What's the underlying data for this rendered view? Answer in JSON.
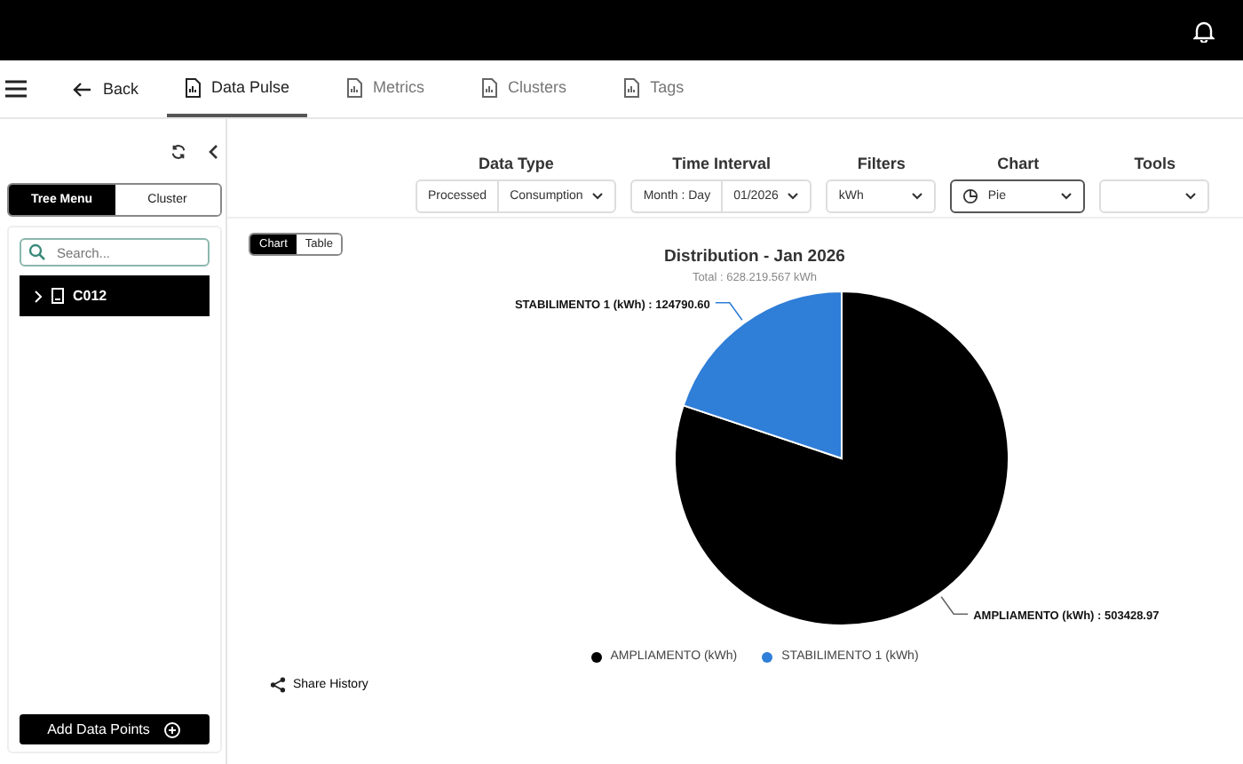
{
  "nav": {
    "back": "Back",
    "tabs": [
      {
        "label": "Data Pulse",
        "selected": true
      },
      {
        "label": "Metrics",
        "selected": false
      },
      {
        "label": "Clusters",
        "selected": false
      },
      {
        "label": "Tags",
        "selected": false
      }
    ]
  },
  "sidebar": {
    "toggle": [
      {
        "label": "Tree Menu",
        "selected": true
      },
      {
        "label": "Cluster",
        "selected": false
      }
    ],
    "search": {
      "placeholder": "Search..."
    },
    "tree": [
      {
        "label": "C012",
        "expanded": false,
        "selected": true
      }
    ],
    "add_button": "Add Data Points"
  },
  "toolbar": [
    {
      "label": "Data Type",
      "kind": "select",
      "focused": false,
      "segments": [
        {
          "value": "Processed",
          "dropdown": false
        },
        {
          "value": "Consumption",
          "dropdown": true
        }
      ]
    },
    {
      "label": "Time Interval",
      "kind": "select",
      "focused": false,
      "segments": [
        {
          "value": "Month : Day",
          "dropdown": false
        },
        {
          "value": "01/2026",
          "dropdown": true
        }
      ]
    },
    {
      "label": "Filters",
      "kind": "select",
      "focused": false,
      "segments": [
        {
          "value": "kWh",
          "dropdown": true
        }
      ]
    },
    {
      "label": "Chart",
      "kind": "chart-select",
      "focused": true,
      "segments": [
        {
          "value": "Pie",
          "dropdown": true
        }
      ]
    },
    {
      "label": "Tools",
      "kind": "select",
      "focused": false,
      "segments": [
        {
          "dropdown": true
        }
      ]
    }
  ],
  "view_toggle": [
    {
      "label": "Chart",
      "selected": true
    },
    {
      "label": "Table",
      "selected": false
    }
  ],
  "chart": {
    "subtitle": "Total : 628.219.567 kWh",
    "slice_labels": [
      "AMPLIAMENTO (kWh) : 503428.97",
      "STABILIMENTO 1 (kWh) : 124790.60"
    ],
    "slices": [
      {
        "color": "#000000"
      },
      {
        "color": "#2f7ed8"
      }
    ],
    "chart_data": {
      "type": "pie",
      "title": "Distribution - Jan 2026",
      "categories": [
        "AMPLIAMENTO (kWh)",
        "STABILIMENTO 1 (kWh)"
      ],
      "values": [
        80.14,
        19.86
      ],
      "legend": "bottom"
    }
  },
  "share": "Share History"
}
